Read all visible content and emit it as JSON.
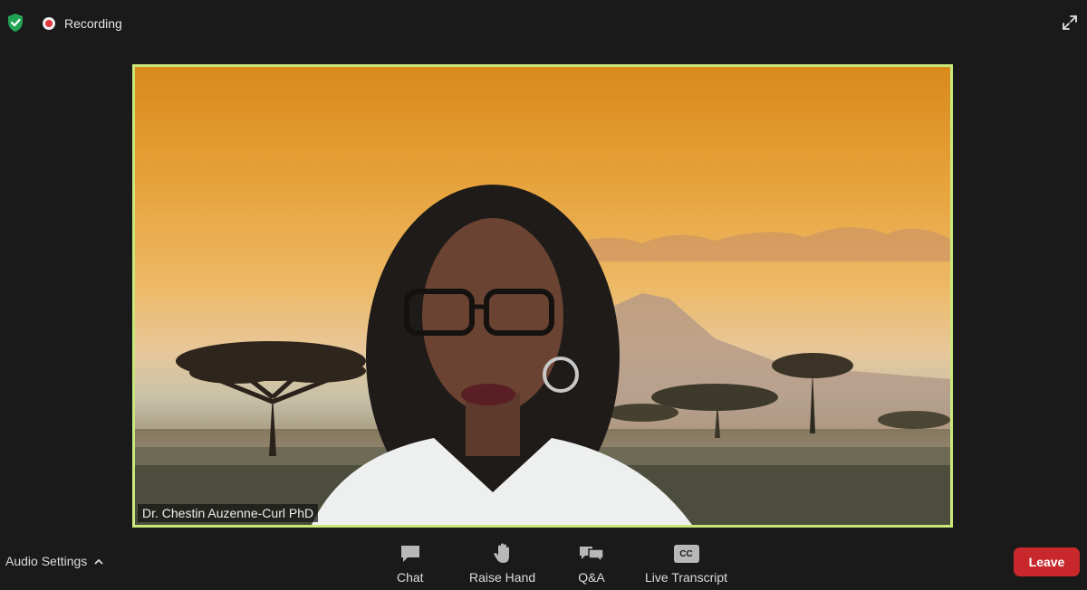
{
  "topbar": {
    "recording_label": "Recording"
  },
  "video": {
    "participant_name": "Dr. Chestin Auzenne-Curl PhD",
    "active_speaker_border": "#c9e879"
  },
  "toolbar": {
    "audio_settings_label": "Audio Settings",
    "chat_label": "Chat",
    "raise_hand_label": "Raise Hand",
    "qa_label": "Q&A",
    "live_transcript_label": "Live Transcript",
    "cc_text": "CC",
    "leave_label": "Leave"
  },
  "colors": {
    "background": "#1a1a1a",
    "leave": "#c8282c",
    "shield": "#23a455",
    "recording": "#e0393e"
  },
  "icons": [
    "shield-check-icon",
    "recording-icon",
    "fullscreen-icon",
    "chevron-up-icon",
    "chat-icon",
    "raise-hand-icon",
    "qa-icon",
    "cc-icon"
  ]
}
